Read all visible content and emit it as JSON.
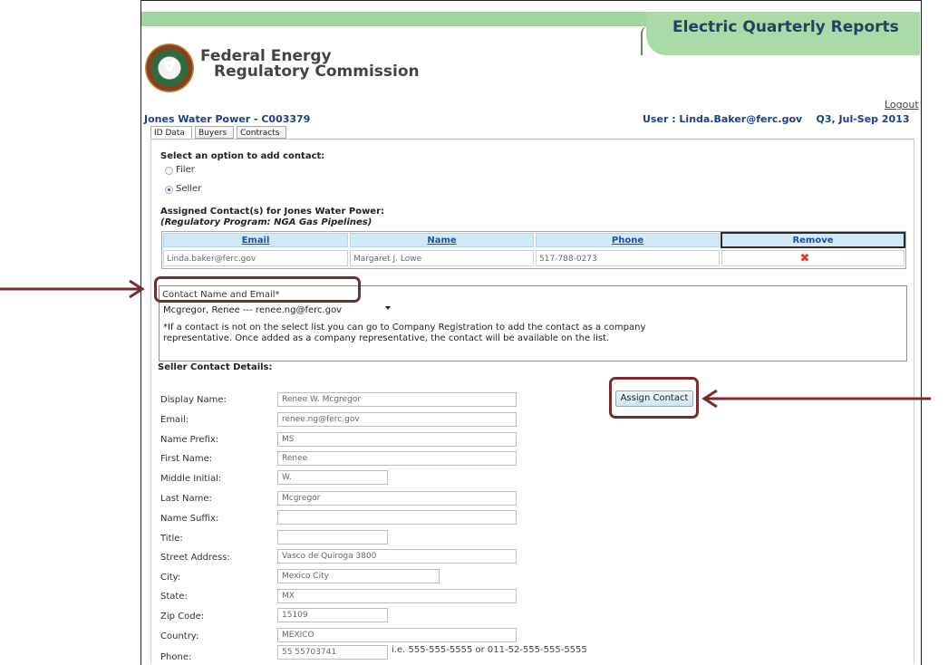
{
  "header": {
    "app_title": "Electric Quarterly Reports",
    "agency_line1": "Federal Energy",
    "agency_line2": "Regulatory Commission",
    "logout": "Logout",
    "company": "Jones Water Power - C003379",
    "user": "User : Linda.Baker@ferc.gov",
    "period": "Q3, Jul-Sep 2013"
  },
  "tabs": [
    "ID Data",
    "Buyers",
    "Contracts"
  ],
  "contact_option": {
    "prompt": "Select an option to add contact:",
    "options": [
      {
        "label": "Filer",
        "selected": false
      },
      {
        "label": "Seller",
        "selected": true
      }
    ]
  },
  "assigned": {
    "title": "Assigned Contact(s) for Jones Water Power:",
    "program": "(Regulatory Program: NGA Gas Pipelines)",
    "columns": [
      "Email",
      "Name",
      "Phone",
      "Remove"
    ],
    "rows": [
      {
        "email": "Linda.baker@ferc.gov",
        "name": "Margaret J. Lowe",
        "phone": "517-788-0273"
      }
    ]
  },
  "contact_select": {
    "label": "Contact Name and Email*",
    "selected": "Mcgregor, Renee --- renee.ng@ferc.gov",
    "note": "*If a contact is not on the select list you can go to Company Registration to add the contact as a company representative. Once added as a company representative, the contact will be available on the list."
  },
  "details": {
    "section_title": "Seller Contact Details:",
    "assign_button": "Assign Contact",
    "fields": [
      {
        "label": "Display Name:",
        "value": "Renee W. Mcgregor"
      },
      {
        "label": "Email:",
        "value": "renee.ng@ferc.gov"
      },
      {
        "label": "Name Prefix:",
        "value": "MS"
      },
      {
        "label": "First Name:",
        "value": "Renee"
      },
      {
        "label": "Middle Initial:",
        "value": "W."
      },
      {
        "label": "Last Name:",
        "value": "Mcgregor"
      },
      {
        "label": "Name Suffix:",
        "value": ""
      },
      {
        "label": "Title:",
        "value": ""
      },
      {
        "label": "Street Address:",
        "value": "Vasco de Quiroga 3800"
      },
      {
        "label": "City:",
        "value": "Mexico City"
      },
      {
        "label": "State:",
        "value": "MX"
      },
      {
        "label": "Zip Code:",
        "value": "15109"
      },
      {
        "label": "Country:",
        "value": "MEXICO"
      },
      {
        "label": "Phone:",
        "value": "55 55703741"
      }
    ],
    "phone_hint": "i.e. 555-555-5555 or 011-52-555-555-5555"
  },
  "colors": {
    "header_green": "#a8dba8",
    "title_blue": "#24415f",
    "link_blue": "#1b3f8b",
    "callout": "#7b2b2b",
    "remove_red": "#e03c28"
  }
}
